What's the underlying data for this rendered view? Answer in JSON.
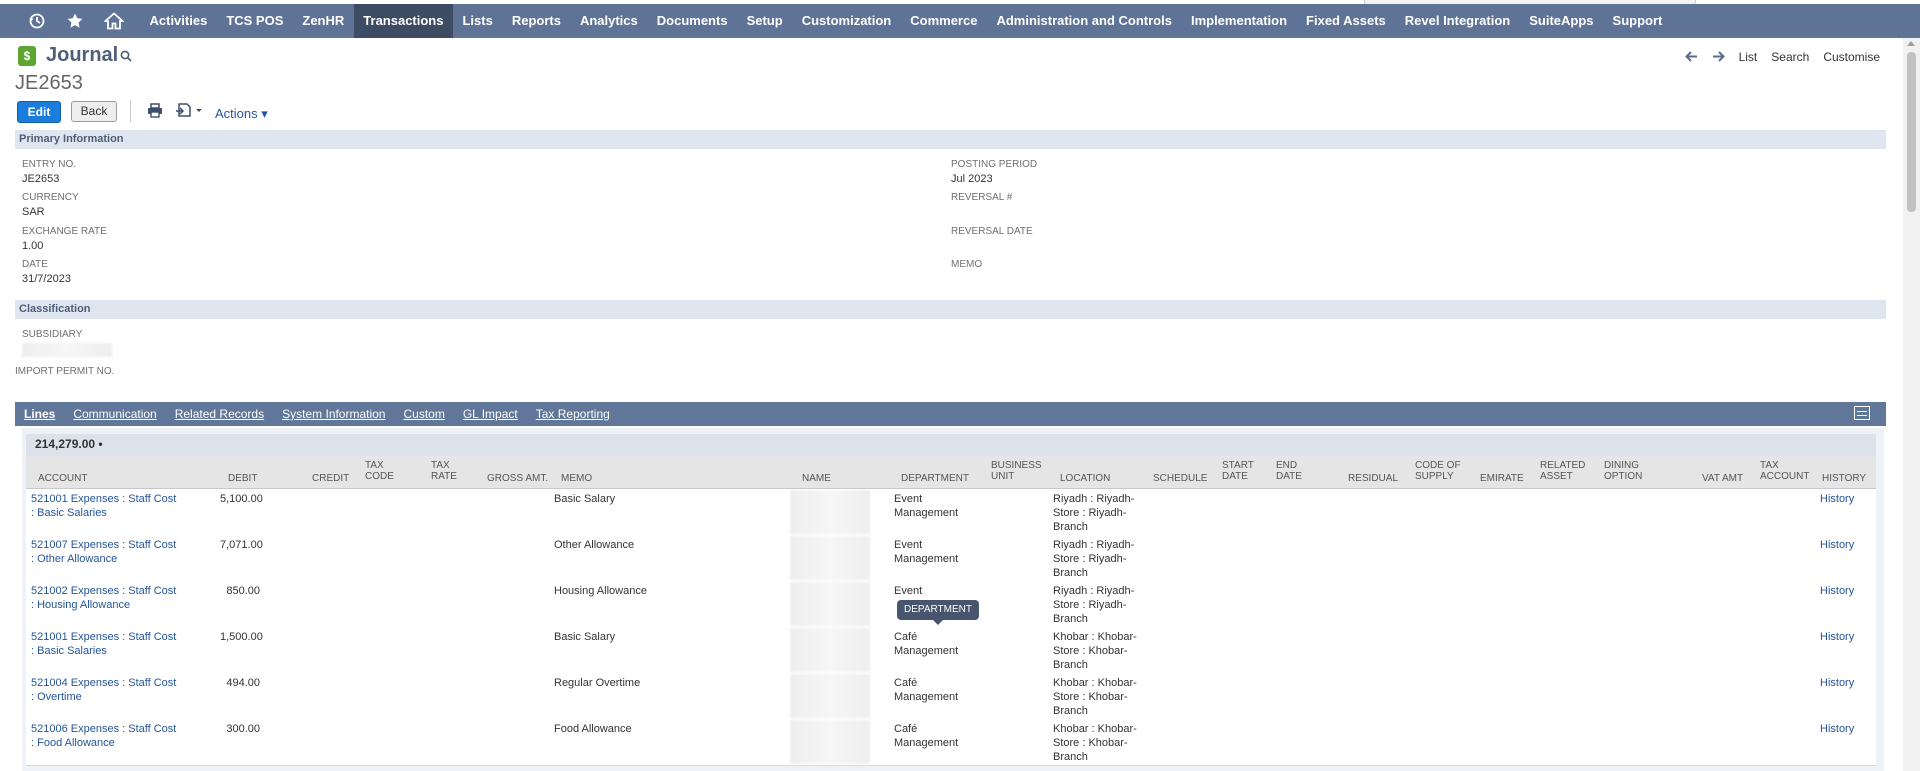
{
  "nav": {
    "icons": [
      "recent-records-icon",
      "favorites-star-icon",
      "home-icon"
    ],
    "items": [
      {
        "label": "Activities"
      },
      {
        "label": "TCS POS"
      },
      {
        "label": "ZenHR"
      },
      {
        "label": "Transactions"
      },
      {
        "label": "Lists"
      },
      {
        "label": "Reports"
      },
      {
        "label": "Analytics"
      },
      {
        "label": "Documents"
      },
      {
        "label": "Setup"
      },
      {
        "label": "Customization"
      },
      {
        "label": "Commerce"
      },
      {
        "label": "Administration and Controls"
      },
      {
        "label": "Implementation"
      },
      {
        "label": "Fixed Assets"
      },
      {
        "label": "Revel Integration"
      },
      {
        "label": "SuiteApps"
      },
      {
        "label": "Support"
      }
    ],
    "active": "Transactions",
    "color": "#5f7396"
  },
  "header": {
    "icon_glyph": "$",
    "title": "Journal",
    "record_id": "JE2653",
    "links": {
      "list": "List",
      "search": "Search",
      "customise": "Customise"
    }
  },
  "toolbar": {
    "edit": "Edit",
    "back": "Back",
    "actions": "Actions ▾"
  },
  "primary": {
    "section_title": "Primary Information",
    "entry_no_label": "Entry No.",
    "entry_no": "JE2653",
    "currency_label": "Currency",
    "currency": "SAR",
    "exchange_rate_label": "Exchange Rate",
    "exchange_rate": "1.00",
    "date_label": "Date",
    "date": "31/7/2023",
    "posting_period_label": "Posting Period",
    "posting_period": "Jul 2023",
    "reversal_no_label": "Reversal #",
    "reversal_date_label": "Reversal Date",
    "memo_label": "Memo"
  },
  "classification": {
    "section_title": "Classification",
    "subsidiary_label": "Subsidiary",
    "import_permit_label": "Import Permit No."
  },
  "tabs": [
    {
      "label": "Lines"
    },
    {
      "label": "Communication"
    },
    {
      "label": "Related Records"
    },
    {
      "label": "System Information"
    },
    {
      "label": "Custom"
    },
    {
      "label": "GL Impact"
    },
    {
      "label": "Tax Reporting"
    }
  ],
  "lines": {
    "total": "214,279.00 •",
    "columns": {
      "account": "Account",
      "debit": "Debit",
      "credit": "Credit",
      "tax_code": "Tax Code",
      "tax_rate": "Tax Rate",
      "gross_amt": "Gross Amt.",
      "memo": "Memo",
      "name": "Name",
      "department": "Department",
      "business_unit": "Business Unit",
      "location": "Location",
      "schedule": "Schedule",
      "start_date": "Start Date",
      "end_date": "End Date",
      "residual": "Residual",
      "code_of_supply": "Code of Supply",
      "emirate": "Emirate",
      "related_asset": "Related Asset",
      "dining_option": "Dining Option",
      "vat_amt": "VAT Amt",
      "tax_account": "Tax Account",
      "history": "History"
    },
    "rows": [
      {
        "account_1": "521001 Expenses : Staff Cost",
        "account_2": ": Basic Salaries",
        "debit": "5,100.00",
        "memo": "Basic Salary",
        "dept_1": "Event",
        "dept_2": "Management",
        "loc_1": "Riyadh : Riyadh-",
        "loc_2": "Store : Riyadh-",
        "loc_3": "Branch",
        "history": "History"
      },
      {
        "account_1": "521007 Expenses : Staff Cost",
        "account_2": ": Other Allowance",
        "debit": "7,071.00",
        "memo": "Other Allowance",
        "dept_1": "Event",
        "dept_2": "Management",
        "loc_1": "Riyadh : Riyadh-",
        "loc_2": "Store : Riyadh-",
        "loc_3": "Branch",
        "history": "History"
      },
      {
        "account_1": "521002 Expenses : Staff Cost",
        "account_2": ": Housing Allowance",
        "debit": "850.00",
        "memo": "Housing Allowance",
        "dept_1": "Event",
        "dept_2": "",
        "loc_1": "Riyadh : Riyadh-",
        "loc_2": "Store : Riyadh-",
        "loc_3": "Branch",
        "history": "History"
      },
      {
        "account_1": "521001 Expenses : Staff Cost",
        "account_2": ": Basic Salaries",
        "debit": "1,500.00",
        "memo": "Basic Salary",
        "dept_1": "Café",
        "dept_2": "Management",
        "loc_1": "Khobar : Khobar-",
        "loc_2": "Store : Khobar-",
        "loc_3": "Branch",
        "history": "History"
      },
      {
        "account_1": "521004 Expenses : Staff Cost",
        "account_2": ": Overtime",
        "debit": "494.00",
        "memo": "Regular Overtime",
        "dept_1": "Café",
        "dept_2": "Management",
        "loc_1": "Khobar : Khobar-",
        "loc_2": "Store : Khobar-",
        "loc_3": "Branch",
        "history": "History"
      },
      {
        "account_1": "521006 Expenses : Staff Cost",
        "account_2": ": Food Allowance",
        "debit": "300.00",
        "memo": "Food Allowance",
        "dept_1": "Café",
        "dept_2": "Management",
        "loc_1": "Khobar : Khobar-",
        "loc_2": "Store : Khobar-",
        "loc_3": "Branch",
        "history": "History"
      }
    ]
  },
  "tooltip": "Department"
}
